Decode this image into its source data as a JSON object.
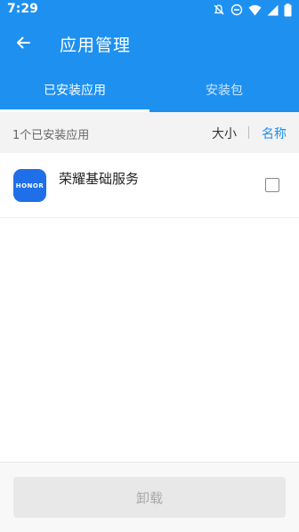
{
  "status_bar": {
    "time": "7:29",
    "icons": [
      "notifications-off-icon",
      "do-not-disturb-icon",
      "wifi-icon",
      "signal-icon",
      "battery-icon"
    ]
  },
  "app_bar": {
    "title": "应用管理",
    "back_icon": "arrow-left-icon"
  },
  "tabs": [
    {
      "label": "已安装应用",
      "selected": true
    },
    {
      "label": "安装包",
      "selected": false
    }
  ],
  "summary": {
    "count_text": "1个已安装应用",
    "sort_size": "大小",
    "sort_name": "名称",
    "active_sort": "名称"
  },
  "apps": [
    {
      "icon_text": "HONOR",
      "name": "荣耀基础服务",
      "checked": false
    }
  ],
  "bottom": {
    "uninstall_label": "卸载"
  },
  "colors": {
    "primary": "#1e90f0",
    "icon_bg": "#1f6fe8"
  }
}
